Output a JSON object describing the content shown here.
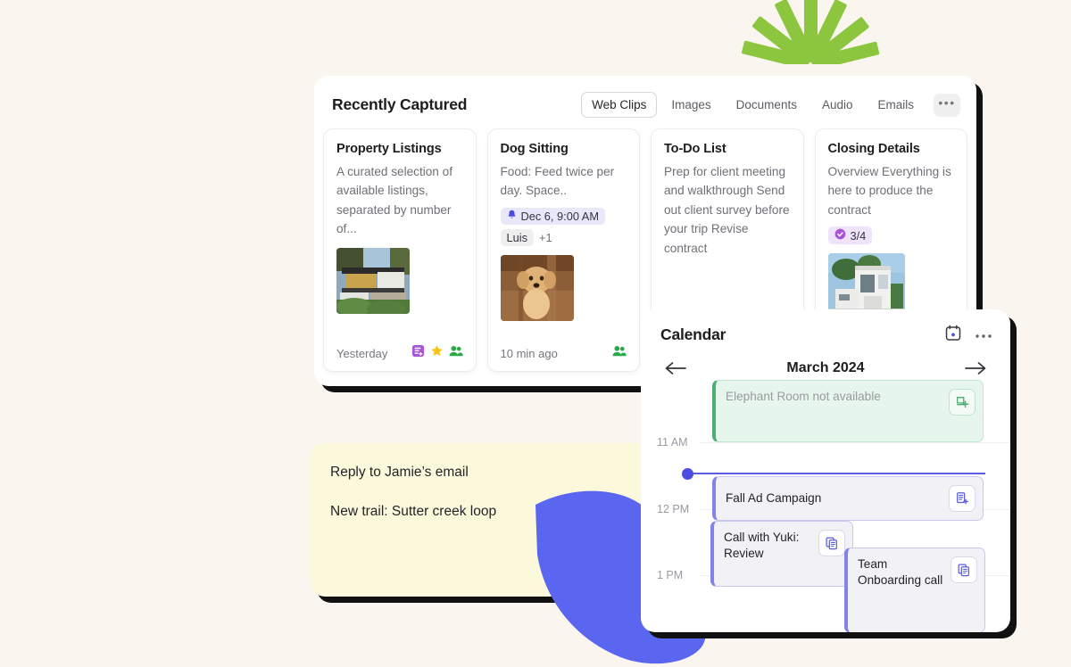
{
  "theme": {
    "background": "#faf6ef",
    "shadow": "#111111",
    "accent_blue": "#5b5ce0",
    "accent_green": "#8cc63e",
    "accent_purple": "#a855d8",
    "note_yellow": "#fcf8dc",
    "blob_blue": "#5b66f0"
  },
  "decorations": {
    "sunburst": {
      "name": "green-sunburst",
      "rays": 7,
      "color": "#8cc63e"
    },
    "blob": {
      "name": "blue-leaf-blob",
      "color": "#5b66f0"
    }
  },
  "captured": {
    "title": "Recently Captured",
    "tabs": [
      {
        "label": "Web Clips",
        "active": true
      },
      {
        "label": "Images",
        "active": false
      },
      {
        "label": "Documents",
        "active": false
      },
      {
        "label": "Audio",
        "active": false
      },
      {
        "label": "Emails",
        "active": false
      }
    ],
    "more_label": "•••",
    "cards": [
      {
        "title": "Property Listings",
        "body": "A curated selection of available listings, separated by number of...",
        "thumb": "house-exterior-dusk",
        "time": "Yesterday",
        "icons": [
          "note-purple-icon",
          "star-yellow-icon",
          "people-green-icon"
        ]
      },
      {
        "title": "Dog Sitting",
        "body": "Food: Feed twice per day. Space..",
        "reminder": "Dec 6, 9:00 AM",
        "person": "Luis",
        "person_extra": "+1",
        "thumb": "poodle-puppy",
        "time": "10 min ago",
        "icons": [
          "people-green-icon"
        ]
      },
      {
        "title": "To-Do List",
        "body": "Prep for client meeting and walkthrough Send out client survey before your trip Revise contract",
        "time": "",
        "icons": []
      },
      {
        "title": "Closing Details",
        "body": "Overview Everything is here to produce the contract",
        "progress": "3/4",
        "thumb": "modern-white-villa",
        "time": "",
        "icons": []
      }
    ]
  },
  "note": {
    "lines": [
      "Reply to Jamie’s email",
      "New trail: Sutter creek loop"
    ]
  },
  "calendar": {
    "title": "Calendar",
    "header_icons": [
      "calendar-dot-icon",
      "more-horizontal-icon"
    ],
    "prev_label": "←",
    "next_label": "→",
    "month": "March 2024",
    "hours": [
      "11 AM",
      "12 PM",
      "1 PM"
    ],
    "events": [
      {
        "title": "Elephant Room not available",
        "style": "green",
        "button": "add-note-green-icon"
      },
      {
        "title": "Fall Ad Campaign",
        "style": "gray",
        "button": "add-note-icon"
      },
      {
        "title": "Call with Yuki: Review",
        "style": "gray",
        "button": "copy-note-icon"
      },
      {
        "title": "Team Onboarding call",
        "style": "gray",
        "button": "copy-note-icon"
      }
    ],
    "now_indicator": true
  }
}
